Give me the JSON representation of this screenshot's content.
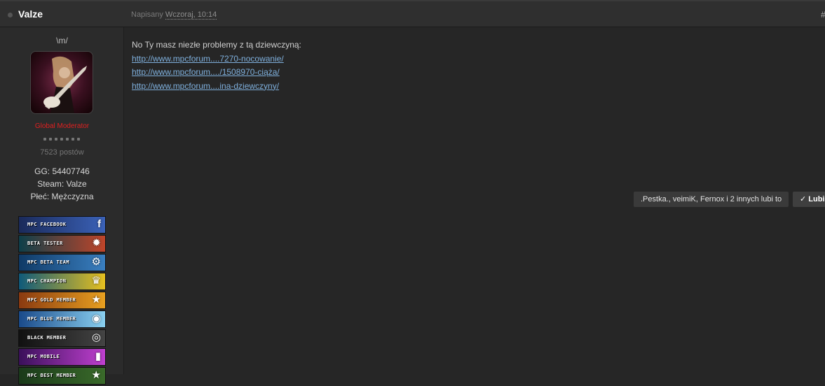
{
  "post": {
    "author": "Valze",
    "date_prefix": "Napisany",
    "date_time": "Wczoraj, 10:14",
    "number_symbol": "#",
    "body_text": "No Ty masz niezłe problemy z tą dziewczyną:",
    "links": [
      "http://www.mpcforum....7270-nocowanie/",
      "http://www.mpcforum..../1508970-ciąża/",
      "http://www.mpcforum....ina-dziewczyny/"
    ],
    "likes_text": ".Pestka., veimiK, Fernox i 2 innych lubi to",
    "like_button": "✓ Lubię"
  },
  "author": {
    "custom_title": "\\m/",
    "group": "Global Moderator",
    "group_color": "#e02020",
    "post_count": "7523 postów",
    "fields": [
      "GG: 54407746",
      "Steam: Valze",
      "Płeć: Mężczyzna"
    ]
  },
  "awards": [
    {
      "label": "MPC FACEBOOK",
      "icon": "facebook-icon",
      "glyph": "f",
      "colors": [
        "#1a2a5a",
        "#3b62b8"
      ]
    },
    {
      "label": "BETA TESTER",
      "icon": "bug-icon",
      "glyph": "✹",
      "colors": [
        "#0d3f4a",
        "#c0452a"
      ]
    },
    {
      "label": "MPC BETA TEAM",
      "icon": "gears-icon",
      "glyph": "⚙",
      "colors": [
        "#0f3a66",
        "#3a7fc0"
      ]
    },
    {
      "label": "MPC CHAMPION",
      "icon": "trophy-icon",
      "glyph": "♛",
      "colors": [
        "#0f5a7a",
        "#e6c020"
      ]
    },
    {
      "label": "MPC GOLD MEMBER",
      "icon": "gold-star-icon",
      "glyph": "★",
      "colors": [
        "#8a3a10",
        "#e8a020"
      ]
    },
    {
      "label": "MPC BLUE MEMBER",
      "icon": "blue-orb-icon",
      "glyph": "◉",
      "colors": [
        "#1a4a8a",
        "#8ad0f0"
      ]
    },
    {
      "label": "BLACK MEMBER",
      "icon": "black-orb-icon",
      "glyph": "◎",
      "colors": [
        "#111111",
        "#444444"
      ]
    },
    {
      "label": "MPC MOBILE",
      "icon": "mobile-icon",
      "glyph": "▮",
      "colors": [
        "#3a105a",
        "#c040d0"
      ]
    },
    {
      "label": "MPC BEST MEMBER",
      "icon": "best-star-icon",
      "glyph": "★",
      "colors": [
        "#1a3a1a",
        "#3a6a2a"
      ]
    }
  ]
}
